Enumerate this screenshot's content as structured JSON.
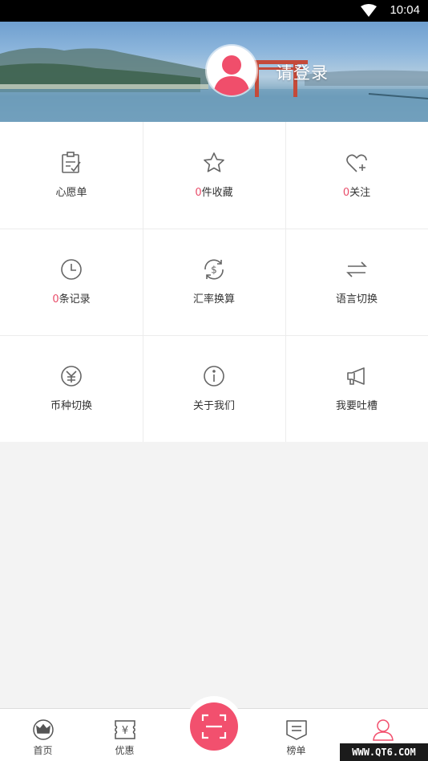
{
  "status_bar": {
    "time": "10:04"
  },
  "header": {
    "login_text": "请登录"
  },
  "grid": [
    {
      "icon": "clipboard-icon",
      "count": "",
      "label": "心愿单"
    },
    {
      "icon": "star-icon",
      "count": "0",
      "label": "件收藏"
    },
    {
      "icon": "heart-plus-icon",
      "count": "0",
      "label": "关注"
    },
    {
      "icon": "clock-icon",
      "count": "0",
      "label": "条记录"
    },
    {
      "icon": "exchange-rate-icon",
      "count": "",
      "label": "汇率换算"
    },
    {
      "icon": "swap-arrows-icon",
      "count": "",
      "label": "语言切换"
    },
    {
      "icon": "currency-icon",
      "count": "",
      "label": "币种切换"
    },
    {
      "icon": "info-icon",
      "count": "",
      "label": "关于我们"
    },
    {
      "icon": "megaphone-icon",
      "count": "",
      "label": "我要吐槽"
    }
  ],
  "tabbar": [
    {
      "icon": "crown-icon",
      "label": "首页"
    },
    {
      "icon": "coupon-icon",
      "label": "优惠"
    },
    {
      "icon": "scan-icon",
      "label": ""
    },
    {
      "icon": "ranking-icon",
      "label": "榜单"
    },
    {
      "icon": "user-icon",
      "label": ""
    }
  ],
  "colors": {
    "accent": "#f2506e",
    "count": "#e84d6a"
  },
  "watermark": "WWW.QT6.COM"
}
